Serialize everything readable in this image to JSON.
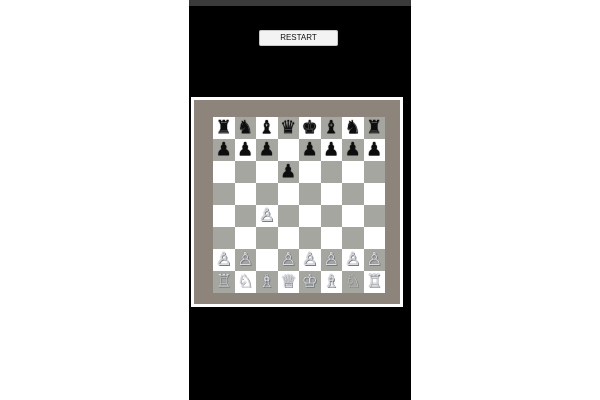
{
  "restart_label": "RESTART",
  "colors": {
    "background": "#000000",
    "light_square": "#ffffff",
    "dark_square": "#a6a6a0",
    "frame": "#8d857c"
  },
  "board": [
    [
      "r",
      "n",
      "b",
      "q",
      "k",
      "b",
      "n",
      "r"
    ],
    [
      "p",
      "p",
      "p",
      "",
      "p",
      "p",
      "p",
      "p"
    ],
    [
      "",
      "",
      "",
      "p",
      "",
      "",
      "",
      ""
    ],
    [
      "",
      "",
      "",
      "",
      "",
      "",
      "",
      ""
    ],
    [
      "",
      "",
      "P",
      "",
      "",
      "",
      "",
      ""
    ],
    [
      "",
      "",
      "",
      "",
      "",
      "",
      "",
      ""
    ],
    [
      "P",
      "P",
      "",
      "P",
      "P",
      "P",
      "P",
      "P"
    ],
    [
      "R",
      "N",
      "B",
      "Q",
      "K",
      "B",
      "N",
      "R"
    ]
  ],
  "piece_glyphs": {
    "K": "♔",
    "Q": "♕",
    "R": "♖",
    "B": "♗",
    "N": "♘",
    "P": "♙",
    "k": "♚",
    "q": "♛",
    "r": "♜",
    "b": "♝",
    "n": "♞",
    "p": "♟"
  },
  "piece_names": {
    "k": "king",
    "q": "queen",
    "r": "rook",
    "b": "bishop",
    "n": "knight",
    "p": "pawn"
  }
}
